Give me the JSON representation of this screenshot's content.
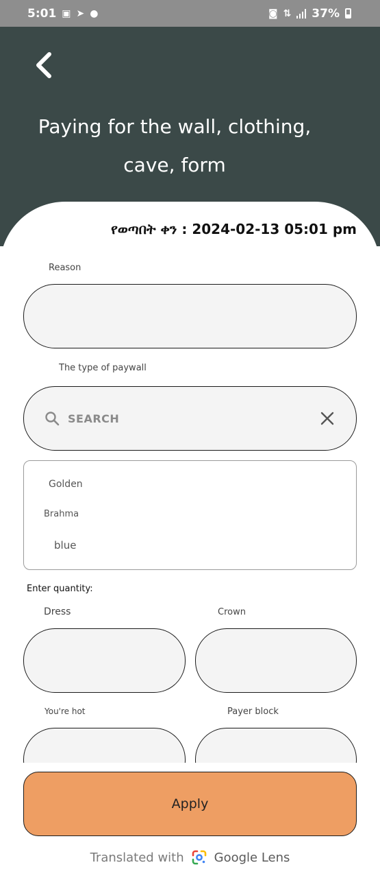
{
  "status_bar": {
    "time": "5:01",
    "battery": "37%"
  },
  "header": {
    "title_line1": "Paying for the wall, clothing,",
    "title_line2": "cave, form"
  },
  "form": {
    "date_label": "የወጣበት ቀን : 2024-02-13 05:01 pm",
    "reason_label": "Reason",
    "reason_value": "",
    "type_label": "The type of paywall",
    "search_placeholder": "SEARCH",
    "options": [
      "Golden",
      "Brahma",
      "blue"
    ],
    "quantity_label": "Enter quantity:",
    "fields": [
      {
        "label": "Dress",
        "value": ""
      },
      {
        "label": "Crown",
        "value": ""
      },
      {
        "label": "You're hot",
        "value": ""
      },
      {
        "label": "Payer block",
        "value": ""
      }
    ],
    "apply_label": "Apply"
  },
  "footer": {
    "prefix": "Translated with",
    "brand": "Google Lens"
  },
  "colors": {
    "header_bg": "#3b4948",
    "apply_bg": "#ee9e63",
    "field_bg": "#f4f4f4"
  }
}
